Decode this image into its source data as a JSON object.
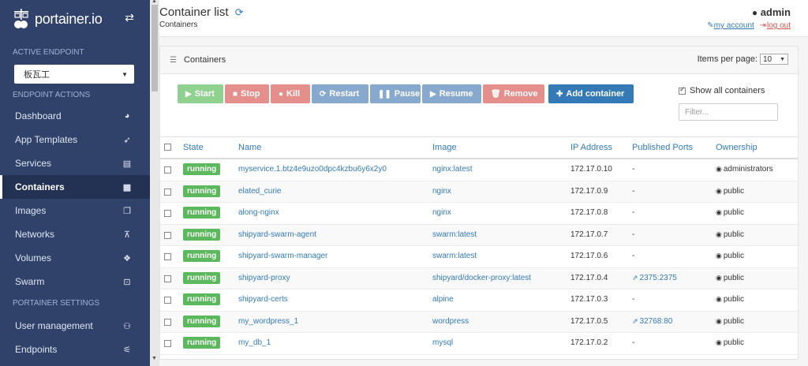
{
  "app": {
    "logo_text": "portainer.io"
  },
  "sidebar": {
    "active_endpoint_label": "ACTIVE ENDPOINT",
    "endpoint_value": "板瓦工",
    "endpoint_actions_label": "ENDPOINT ACTIONS",
    "items": [
      {
        "label": "Dashboard",
        "icon": "tachometer-icon"
      },
      {
        "label": "App Templates",
        "icon": "rocket-icon"
      },
      {
        "label": "Services",
        "icon": "list-alt-icon"
      },
      {
        "label": "Containers",
        "icon": "server-icon",
        "active": true
      },
      {
        "label": "Images",
        "icon": "clone-icon"
      },
      {
        "label": "Networks",
        "icon": "sitemap-icon"
      },
      {
        "label": "Volumes",
        "icon": "cubes-icon"
      },
      {
        "label": "Swarm",
        "icon": "object-group-icon"
      }
    ],
    "settings_label": "PORTAINER SETTINGS",
    "settings_items": [
      {
        "label": "User management",
        "icon": "users-icon"
      },
      {
        "label": "Endpoints",
        "icon": "plug-icon"
      }
    ]
  },
  "header": {
    "title": "Container list",
    "breadcrumb": "Containers",
    "user": "admin",
    "my_account": "my account",
    "log_out": "log out"
  },
  "panel": {
    "title": "Containers",
    "items_per_page_label": "Items per page:",
    "items_per_page_value": "10",
    "show_all_label": "Show all containers",
    "filter_placeholder": "Filter..."
  },
  "actions": {
    "start": "Start",
    "stop": "Stop",
    "kill": "Kill",
    "restart": "Restart",
    "pause": "Pause",
    "resume": "Resume",
    "remove": "Remove",
    "add": "Add container"
  },
  "table": {
    "columns": [
      "State",
      "Name",
      "Image",
      "IP Address",
      "Published Ports",
      "Ownership"
    ],
    "rows": [
      {
        "state": "running",
        "name": "myservice.1.btz4e9uzo0dpc4kzbu6y6x2y0",
        "image": "nginx:latest",
        "ip": "172.17.0.10",
        "ports": "-",
        "ownership": "administrators"
      },
      {
        "state": "running",
        "name": "elated_curie",
        "image": "nginx",
        "ip": "172.17.0.9",
        "ports": "-",
        "ownership": "public"
      },
      {
        "state": "running",
        "name": "along-nginx",
        "image": "nginx",
        "ip": "172.17.0.8",
        "ports": "-",
        "ownership": "public"
      },
      {
        "state": "running",
        "name": "shipyard-swarm-agent",
        "image": "swarm:latest",
        "ip": "172.17.0.7",
        "ports": "-",
        "ownership": "public"
      },
      {
        "state": "running",
        "name": "shipyard-swarm-manager",
        "image": "swarm:latest",
        "ip": "172.17.0.6",
        "ports": "-",
        "ownership": "public"
      },
      {
        "state": "running",
        "name": "shipyard-proxy",
        "image": "shipyard/docker-proxy:latest",
        "ip": "172.17.0.4",
        "ports": "2375:2375",
        "ownership": "public"
      },
      {
        "state": "running",
        "name": "shipyard-certs",
        "image": "alpine",
        "ip": "172.17.0.3",
        "ports": "-",
        "ownership": "public"
      },
      {
        "state": "running",
        "name": "my_wordpress_1",
        "image": "wordpress",
        "ip": "172.17.0.5",
        "ports": "32768:80",
        "ownership": "public"
      },
      {
        "state": "running",
        "name": "my_db_1",
        "image": "mysql",
        "ip": "172.17.0.2",
        "ports": "-",
        "ownership": "public"
      }
    ]
  },
  "colors": {
    "sidebar_bg": "#30426a",
    "primary": "#337ab7",
    "running_badge": "#5cb85c",
    "danger": "#e48f8b"
  }
}
